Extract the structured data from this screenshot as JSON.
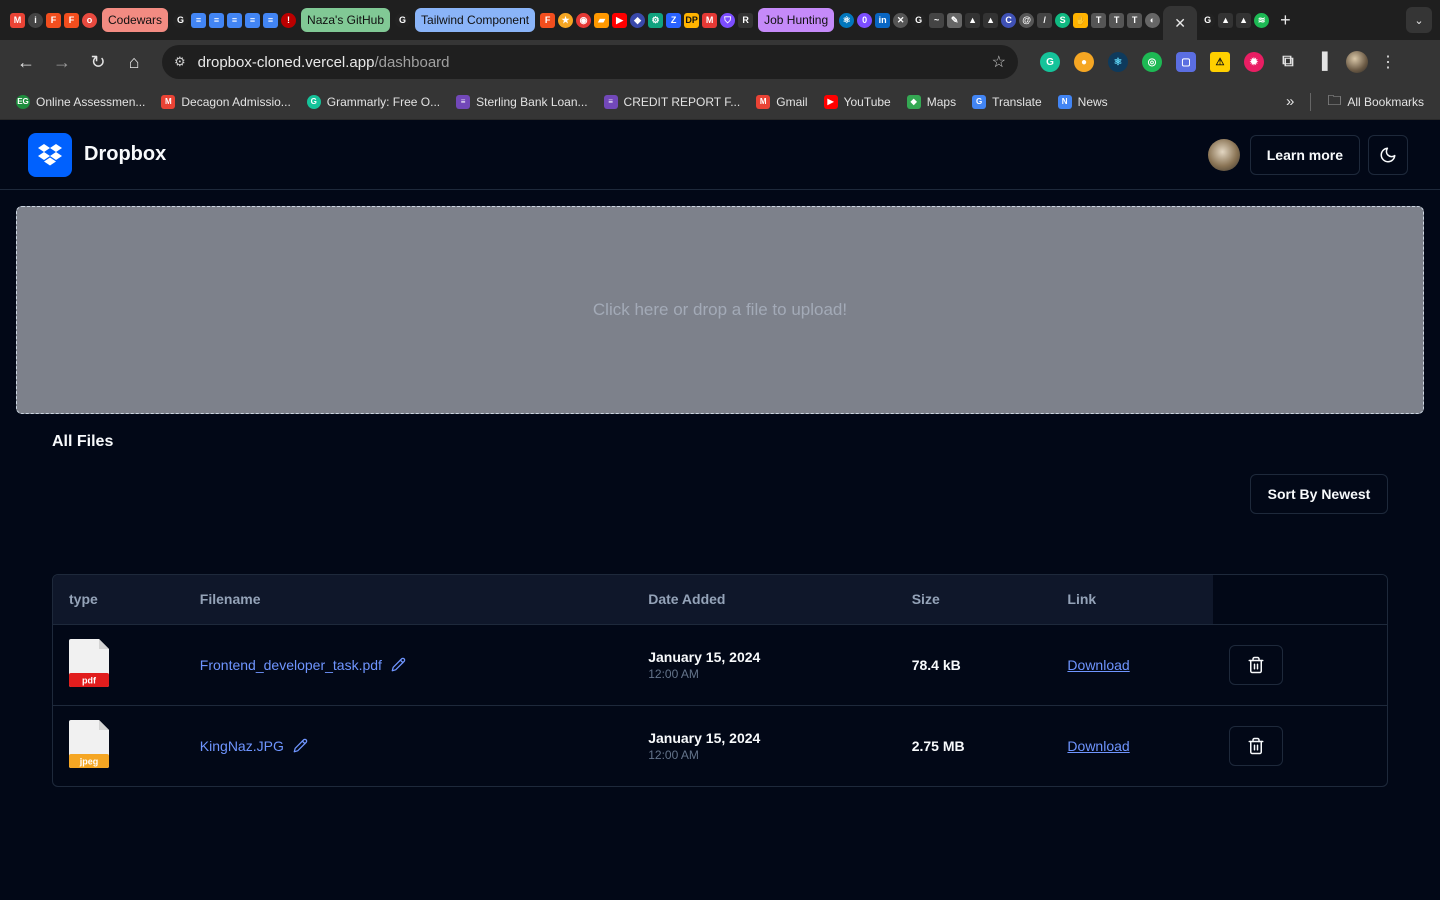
{
  "browser": {
    "tab_groups": [
      {
        "label": "Codewars",
        "color": "#f28b82"
      },
      {
        "label": "Naza's GitHub",
        "color": "#81c995"
      },
      {
        "label": "Tailwind Component",
        "color": "#8ab4f8"
      },
      {
        "label": "Job Hunting",
        "color": "#c58af9"
      }
    ],
    "url_host": "dropbox-cloned.vercel.app",
    "url_path": "/dashboard",
    "bookmarks": [
      {
        "label": "Online Assessmen...",
        "icon": "eg-icon",
        "color": "#1e8e3e"
      },
      {
        "label": "Decagon Admissio...",
        "icon": "gmail-icon",
        "color": "#ea4335"
      },
      {
        "label": "Grammarly: Free O...",
        "icon": "grammarly-icon",
        "color": "#15c39a"
      },
      {
        "label": "Sterling Bank Loan...",
        "icon": "forms-icon",
        "color": "#7248b9"
      },
      {
        "label": "CREDIT REPORT F...",
        "icon": "forms-icon",
        "color": "#7248b9"
      },
      {
        "label": "Gmail",
        "icon": "gmail-icon",
        "color": "#ea4335"
      },
      {
        "label": "YouTube",
        "icon": "youtube-icon",
        "color": "#ff0000"
      },
      {
        "label": "Maps",
        "icon": "maps-icon",
        "color": "#34a853"
      },
      {
        "label": "Translate",
        "icon": "translate-icon",
        "color": "#4285f4"
      },
      {
        "label": "News",
        "icon": "news-icon",
        "color": "#4285f4"
      }
    ],
    "all_bookmarks_label": "All Bookmarks"
  },
  "app": {
    "brand": "Dropbox",
    "learn_more_label": "Learn more",
    "theme_toggle_icon": "moon-icon",
    "dropzone_text": "Click here or drop a file to upload!",
    "section_title": "All Files",
    "sort_label": "Sort By Newest",
    "accent": "#0061fe",
    "link_color": "#6f95ff"
  },
  "table": {
    "headers": [
      "type",
      "Filename",
      "Date Added",
      "Size",
      "Link"
    ],
    "rows": [
      {
        "type": "pdf",
        "type_color": "#e11d1d",
        "filename": "Frontend_developer_task.pdf",
        "date": "January 15, 2024",
        "time": "12:00 AM",
        "size": "78.4 kB",
        "link": "Download"
      },
      {
        "type": "jpeg",
        "type_color": "#f5a623",
        "filename": "KingNaz.JPG",
        "date": "January 15, 2024",
        "time": "12:00 AM",
        "size": "2.75 MB",
        "link": "Download"
      }
    ]
  }
}
